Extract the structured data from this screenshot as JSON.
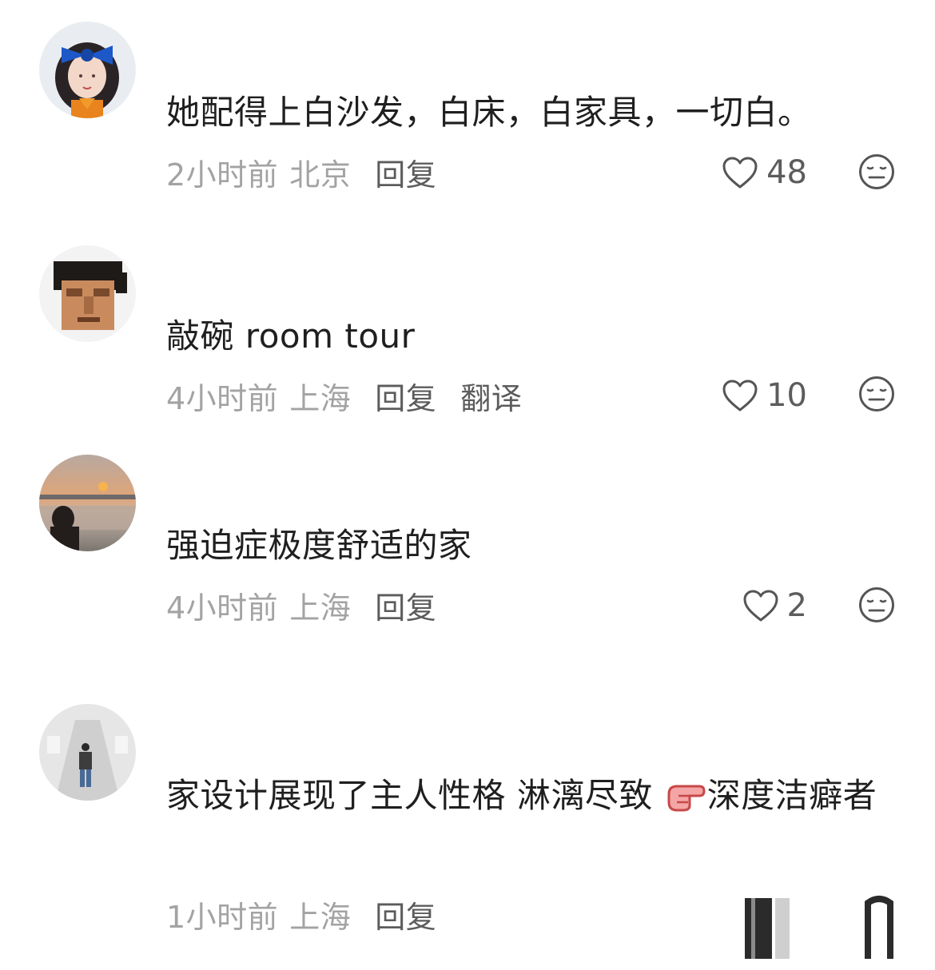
{
  "comments": [
    {
      "text": "她配得上白沙发，白床，白家具，一切白。",
      "time": "2小时前",
      "location": "北京",
      "reply_label": "回复",
      "translate_label": "",
      "likes": "48"
    },
    {
      "text": "敲碗 room tour",
      "time": "4小时前",
      "location": "上海",
      "reply_label": "回复",
      "translate_label": "翻译",
      "likes": "10"
    },
    {
      "text": "强迫症极度舒适的家",
      "time": "4小时前",
      "location": "上海",
      "reply_label": "回复",
      "translate_label": "",
      "likes": "2"
    },
    {
      "text_before_emoji": "家设计展现了主人性格 淋漓尽致 ",
      "text_after_emoji": "深度洁癖者",
      "emoji": "pointing-finger-emoji",
      "time": "1小时前",
      "location": "上海",
      "reply_label": "回复",
      "translate_label": "",
      "likes": ""
    }
  ],
  "icons": {
    "like": "heart-outline-icon",
    "dislike": "neutral-face-icon"
  },
  "colors": {
    "text": "#1f1f1f",
    "meta": "#a3a3a3",
    "action": "#5c5c5c",
    "icon": "#555555"
  }
}
